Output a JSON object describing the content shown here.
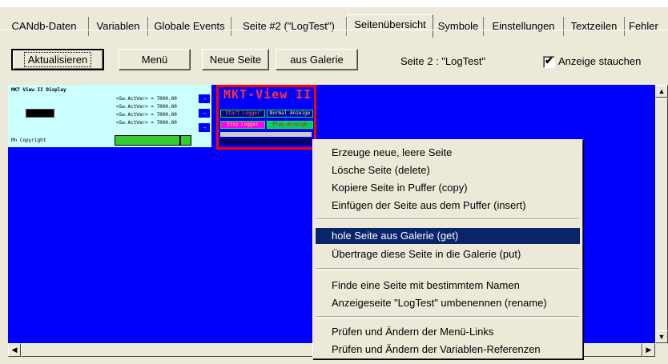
{
  "tabs": [
    {
      "label": "CANdb-Daten"
    },
    {
      "label": "Variablen"
    },
    {
      "label": "Globale Events"
    },
    {
      "label": "Seite #2 (\"LogTest\")"
    },
    {
      "label": "Seitenübersicht"
    },
    {
      "label": "Symbole"
    },
    {
      "label": "Einstellungen"
    },
    {
      "label": "Textzeilen"
    },
    {
      "label": "Fehler"
    }
  ],
  "active_tab": "Seitenübersicht",
  "toolbar": {
    "refresh_label": "Aktualisieren",
    "menu_label": "Menü",
    "new_page_label": "Neue Seite",
    "gallery_label": "aus Galerie",
    "page_info": "Seite 2 : \"LogTest\"",
    "compress_label": "Anzeige stauchen",
    "compress_checked": true,
    "check_glyph": "✔"
  },
  "thumbnails": {
    "page1": {
      "title": "MKT View II Display",
      "lines": [
        "<Sw.ActVer> = 7000.00",
        "<Sw.ActVer> = 7000.00",
        "<Sw.ActVer> = 7000.00",
        "<Sw.ActVer> = 7000.00"
      ],
      "copyright": "Mn Copyright"
    },
    "page2": {
      "title": "MKT-View II",
      "buttons": [
        "Start Logger",
        "Normal Anzeige",
        "Stop Logger",
        "Play Anzeige"
      ]
    }
  },
  "context_menu": {
    "items": [
      {
        "label": "Erzeuge neue, leere Seite"
      },
      {
        "label": "Lösche Seite (delete)"
      },
      {
        "label": "Kopiere Seite in Puffer (copy)"
      },
      {
        "label": "Einfügen der Seite aus dem Puffer (insert)"
      },
      {
        "label": "hole Seite aus Galerie (get)"
      },
      {
        "label": "Übertrage diese Seite in die Galerie (put)"
      },
      {
        "label": "Finde eine Seite mit bestimmtem Namen"
      },
      {
        "label": "Anzeigeseite \"LogTest\" umbenennen (rename)"
      },
      {
        "label": "Prüfen und Ändern der Menü-Links"
      },
      {
        "label": "Prüfen und Ändern der Variablen-Referenzen"
      }
    ],
    "highlighted": "hole Seite aus Galerie (get)"
  },
  "colors": {
    "canvas": "#0000ff",
    "highlight": "#0a246a",
    "thumb_bg": "#ccffff",
    "thumb_border": "#ff0000"
  }
}
